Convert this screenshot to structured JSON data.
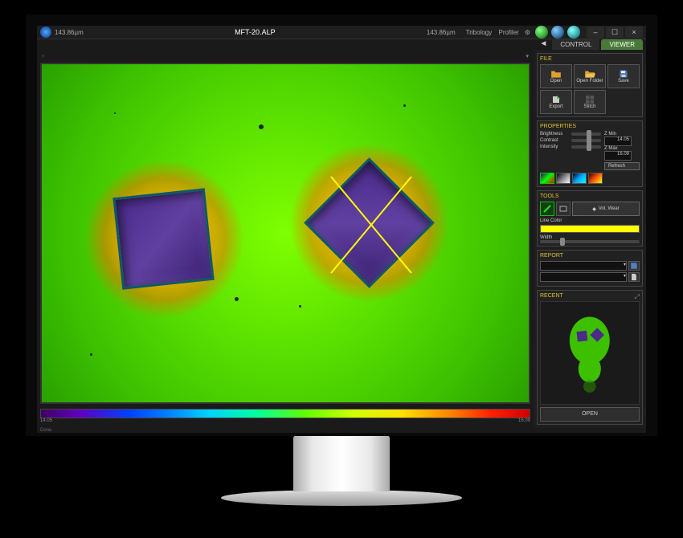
{
  "app": {
    "title": "MFT-20.ALP",
    "scale_left": "143.86µm",
    "scale_right": "143.86µm"
  },
  "topnav": {
    "links": [
      "Tribology",
      "Profiler"
    ]
  },
  "window_controls": {
    "min": "–",
    "max": "☐",
    "close": "×"
  },
  "tabs": {
    "control": "CONTROL",
    "viewer": "VIEWER",
    "active": "viewer"
  },
  "file": {
    "title": "FILE",
    "buttons": {
      "open": "Open",
      "open_folder": "Open Folder",
      "save": "Save",
      "export": "Export",
      "stitch": "Stitch"
    }
  },
  "properties": {
    "title": "PROPERTIES",
    "brightness": "Brightness",
    "contrast": "Contrast",
    "intensity": "Intensity",
    "zmin_label": "Z Min",
    "zmax_label": "Z Max",
    "zmin": "14.05",
    "zmax": "16.09",
    "refresh": "Refresh"
  },
  "tools": {
    "title": "TOOLS",
    "vol_wear": "Vol. Wear",
    "line_color_label": "Line Color",
    "width_label": "Width"
  },
  "report": {
    "title": "REPORT"
  },
  "recent": {
    "title": "RECENT",
    "open": "OPEN"
  },
  "colorbar": {
    "min": "14.05",
    "max": "16.09"
  },
  "status": "Done"
}
